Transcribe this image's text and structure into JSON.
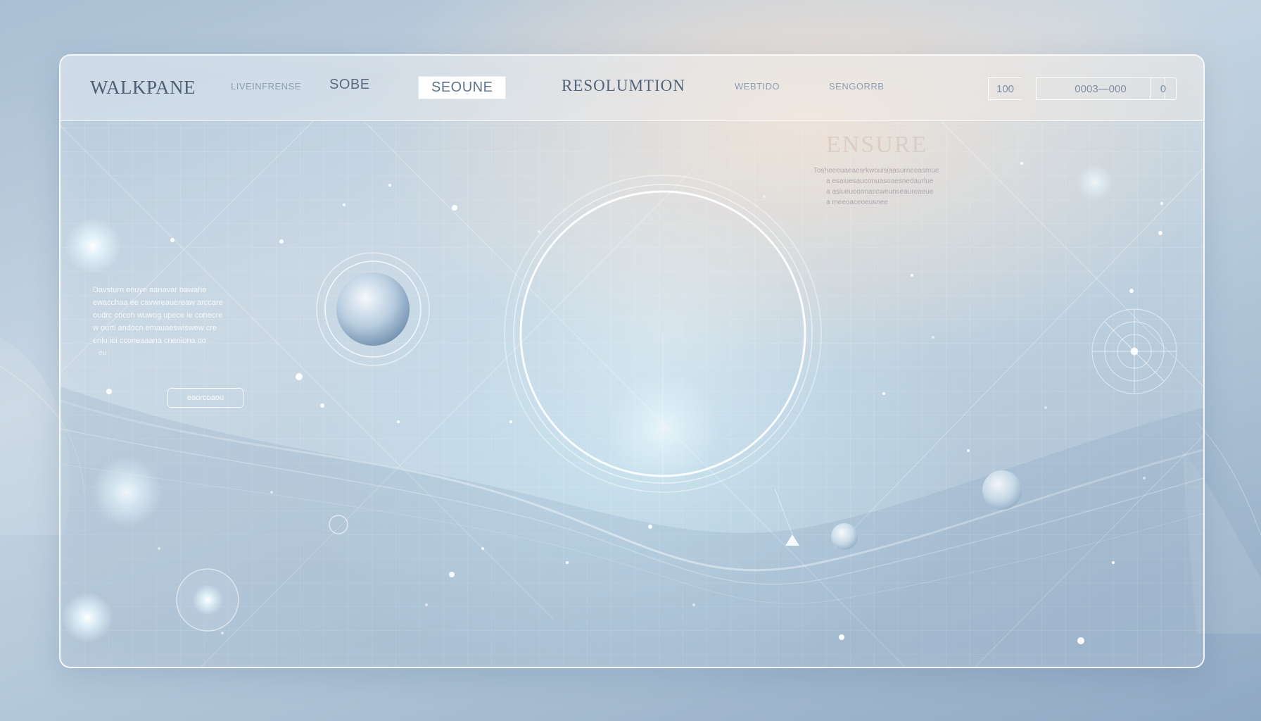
{
  "brand": "WALKPANE",
  "nav": {
    "item1": "LIVEINFRENSE",
    "item2": "SOBE",
    "item3_active": "SEOUNE",
    "item4": "RESOLUMTION",
    "item5": "WEBTIDO",
    "item6": "SENGORRB"
  },
  "top_fields": {
    "field1": "100",
    "field2": "0003—000",
    "field3": "0"
  },
  "left_panel": {
    "lines": [
      "Davsturn enuye aanavar bawahe",
      "ewacchaa ee cavwreauereaw arccare",
      "oudrc cocoh wuwog upece ie conecre",
      "w ourti andocn emauaeswiswew cre",
      "enlu ioi cconeaaana cneniona oo",
      "eu"
    ],
    "button": "eaorcoaou"
  },
  "right_panel": {
    "heading": "ENSURE",
    "lines": [
      "Tosheeeuaeaesrkwouisiaasurneeasmue",
      "a esaiuesauconuasoaesnedaurlue",
      "a asiueuoonnascweunseaureaeue",
      "a meeoaceoeusnee"
    ]
  },
  "colors": {
    "accent_white": "#ffffff",
    "text_slate": "#53647a",
    "bg_blue": "#a9bfd3",
    "bg_peach": "#f8e2d0"
  },
  "icons": [
    "planet-icon",
    "radar-icon",
    "triangle-icon"
  ]
}
